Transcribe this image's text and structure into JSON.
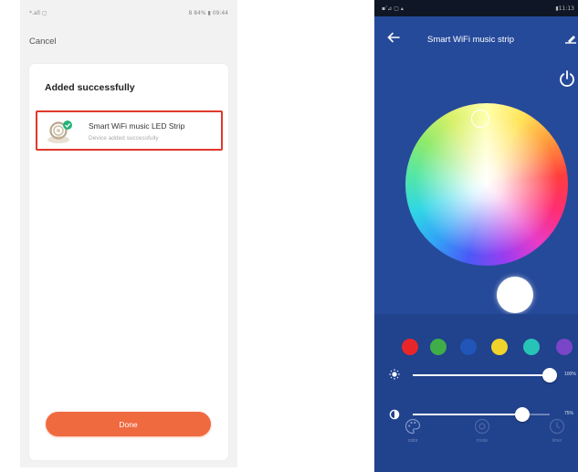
{
  "left_screen": {
    "status_left": "*.all ▢",
    "status_right": "8 84% ▮ 09:44",
    "cancel_label": "Cancel",
    "card_title": "Added successfully",
    "device": {
      "name": "Smart WiFi music LED Strip",
      "status": "Device added successfully"
    },
    "done_label": "Done",
    "colors": {
      "accent": "#f06a40",
      "highlight_border": "#e0382b",
      "check_badge": "#26b37a"
    }
  },
  "right_screen": {
    "status_left": "▪″⊿ ▢ ▴",
    "status_right": "▮11:13",
    "title": "Smart WiFi music strip",
    "swatches": [
      {
        "name": "red",
        "color": "#e8262a"
      },
      {
        "name": "green",
        "color": "#3fae49"
      },
      {
        "name": "blue",
        "color": "#2155b8"
      },
      {
        "name": "yellow",
        "color": "#f0d32b"
      },
      {
        "name": "teal",
        "color": "#28c3b7"
      },
      {
        "name": "purple",
        "color": "#7a45c8"
      }
    ],
    "brightness": {
      "value_label": "100%",
      "level": 1.0
    },
    "saturation": {
      "value_label": "75%",
      "level": 0.8
    },
    "tabs": [
      {
        "label": "color",
        "icon": "palette-icon",
        "active": true
      },
      {
        "label": "mode",
        "icon": "mode-icon",
        "active": false
      },
      {
        "label": "timer",
        "icon": "timer-icon",
        "active": false
      }
    ],
    "colors": {
      "background": "#264a9a",
      "panel": "#21428d"
    }
  }
}
